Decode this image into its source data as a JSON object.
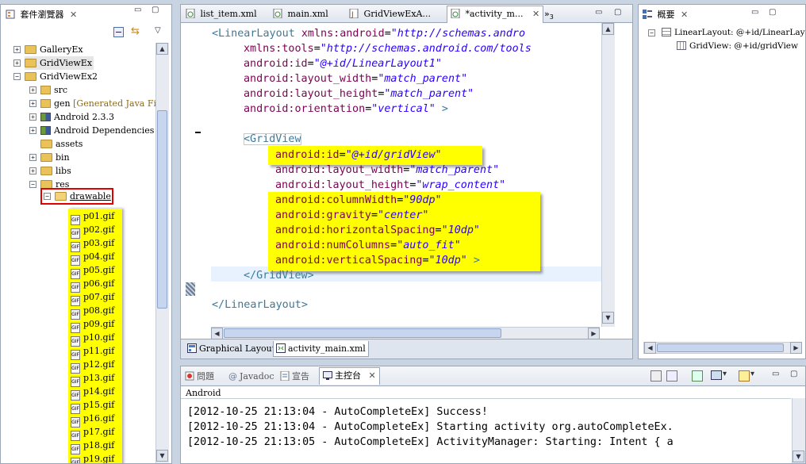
{
  "explorer": {
    "title": "套件瀏覽器",
    "tree": [
      {
        "label": "GalleryEx",
        "expanded": false
      },
      {
        "label": "GridViewEx",
        "expanded": false
      },
      {
        "label": "GridViewEx2",
        "expanded": true
      },
      {
        "label": "src",
        "expanded": false
      },
      {
        "label": "gen",
        "suffix": "[Generated Java Files]",
        "expanded": false
      },
      {
        "label": "Android 2.3.3",
        "expanded": false
      },
      {
        "label": "Android Dependencies",
        "expanded": false
      },
      {
        "label": "assets"
      },
      {
        "label": "bin",
        "expanded": false
      },
      {
        "label": "libs",
        "expanded": false
      },
      {
        "label": "res",
        "expanded": true
      },
      {
        "label": "drawable",
        "expanded": true
      }
    ],
    "files": [
      "p01.gif",
      "p02.gif",
      "p03.gif",
      "p04.gif",
      "p05.gif",
      "p06.gif",
      "p07.gif",
      "p08.gif",
      "p09.gif",
      "p10.gif",
      "p11.gif",
      "p12.gif",
      "p13.gif",
      "p14.gif",
      "p15.gif",
      "p16.gif",
      "p17.gif",
      "p18.gif",
      "p19.gif"
    ]
  },
  "editor": {
    "tabs": [
      {
        "label": "list_item.xml"
      },
      {
        "label": "main.xml"
      },
      {
        "label": "GridViewExA..."
      },
      {
        "label": "*activity_m..."
      }
    ],
    "overflow": "»",
    "overflow_count": "3",
    "bottom_tabs": [
      "Graphical Layout",
      "activity_main.xml"
    ],
    "code": {
      "l1_tag": "<LinearLayout",
      "l1_attr": "xmlns:android",
      "l1_val": "\"http://schemas.andro",
      "l2_attr": "xmlns:tools",
      "l2_val": "\"http://schemas.android.com/tools",
      "l3_attr": "android:id",
      "l3_val": "\"@+id/LinearLayout1\"",
      "l4_attr": "android:layout_width",
      "l4_val": "\"match_parent\"",
      "l5_attr": "android:layout_height",
      "l5_val": "\"match_parent\"",
      "l6_attr": "android:orientation",
      "l6_val": "\"vertical\"",
      "l6_end": " >",
      "l7_tag": "<GridView",
      "l8_attr": "android:id",
      "l8_val": "\"@+id/gridView\"",
      "l9_attr": "android:layout_width",
      "l9_val": "\"match_parent\"",
      "l10_attr": "android:layout_height",
      "l10_val": "\"wrap_content\"",
      "l11_attr": "android:columnWidth",
      "l11_val": "\"90dp\"",
      "l12_attr": "android:gravity",
      "l12_val": "\"center\"",
      "l13_attr": "android:horizontalSpacing",
      "l13_val": "\"10dp\"",
      "l14_attr": "android:numColumns",
      "l14_val": "\"auto_fit\"",
      "l15_attr": "android:verticalSpacing",
      "l15_val": "\"10dp\"",
      "l15_end": " >",
      "l16_tag": "</GridView>",
      "l17_tag": "</LinearLayout>",
      "eq": "="
    }
  },
  "outline": {
    "title": "概要",
    "items": [
      {
        "label": "LinearLayout: @+id/LinearLayou"
      },
      {
        "label": "GridView: @+id/gridView"
      }
    ]
  },
  "console": {
    "tabs": [
      "問題",
      "Javadoc",
      "宣告",
      "主控台"
    ],
    "header": "Android",
    "lines": [
      "[2012-10-25 21:13:04 - AutoCompleteEx] Success!",
      "[2012-10-25 21:13:04 - AutoCompleteEx] Starting activity org.autoCompleteEx.",
      "[2012-10-25 21:13:05 - AutoCompleteEx] ActivityManager: Starting: Intent { a"
    ]
  },
  "colors": {
    "highlight": "#ffff00",
    "annotation_box": "#e00000",
    "xml_tag": "#3a7a9a",
    "xml_attr": "#7f0055",
    "xml_value": "#2a00ff"
  }
}
